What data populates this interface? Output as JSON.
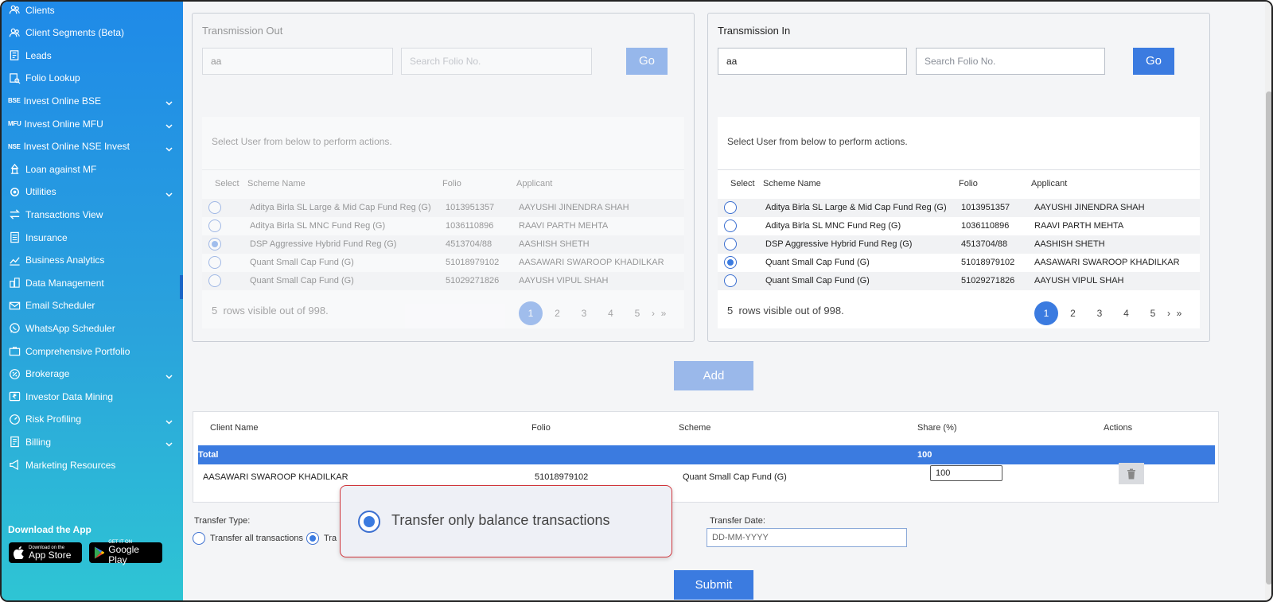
{
  "sidebar": {
    "items": [
      {
        "label": "Clients",
        "icon": "users-icon",
        "tag": "",
        "chevron": false
      },
      {
        "label": "Client Segments (Beta)",
        "icon": "users-icon",
        "tag": "",
        "chevron": false
      },
      {
        "label": "Leads",
        "icon": "notepad-icon",
        "tag": "",
        "chevron": false
      },
      {
        "label": "Folio Lookup",
        "icon": "folio-search-icon",
        "tag": "",
        "chevron": false
      },
      {
        "label": "Invest Online BSE",
        "icon": "bse-icon",
        "tag": "BSE",
        "chevron": true
      },
      {
        "label": "Invest Online MFU",
        "icon": "mfu-icon",
        "tag": "MFU",
        "chevron": true
      },
      {
        "label": "Invest Online NSE Invest",
        "icon": "nse-icon",
        "tag": "NSE",
        "chevron": true
      },
      {
        "label": "Loan against MF",
        "icon": "loan-icon",
        "tag": "",
        "chevron": false
      },
      {
        "label": "Utilities",
        "icon": "utilities-icon",
        "tag": "",
        "chevron": true
      },
      {
        "label": "Transactions View",
        "icon": "transfer-arrows-icon",
        "tag": "",
        "chevron": false
      },
      {
        "label": "Insurance",
        "icon": "document-icon",
        "tag": "",
        "chevron": false
      },
      {
        "label": "Business Analytics",
        "icon": "line-chart-icon",
        "tag": "",
        "chevron": false
      },
      {
        "label": "Data Management",
        "icon": "data-icon",
        "tag": "",
        "chevron": false
      },
      {
        "label": "Email Scheduler",
        "icon": "email-icon",
        "tag": "",
        "chevron": false
      },
      {
        "label": "WhatsApp Scheduler",
        "icon": "whatsapp-icon",
        "tag": "",
        "chevron": false
      },
      {
        "label": "Comprehensive Portfolio",
        "icon": "briefcase-icon",
        "tag": "",
        "chevron": false
      },
      {
        "label": "Brokerage",
        "icon": "percent-icon",
        "tag": "",
        "chevron": true
      },
      {
        "label": "Investor Data Mining",
        "icon": "rupee-icon",
        "tag": "",
        "chevron": false
      },
      {
        "label": "Risk Profiling",
        "icon": "gauge-icon",
        "tag": "",
        "chevron": true
      },
      {
        "label": "Billing",
        "icon": "billing-icon",
        "tag": "",
        "chevron": true
      },
      {
        "label": "Marketing Resources",
        "icon": "marketing-icon",
        "tag": "",
        "chevron": false
      }
    ],
    "download_title": "Download the App",
    "app_store": {
      "small": "Download on the",
      "big": "App Store"
    },
    "google_play": {
      "small": "GET IT ON",
      "big": "Google Play"
    }
  },
  "transmission_out": {
    "title": "Transmission Out",
    "search_value": "aa",
    "folio_placeholder": "Search Folio No.",
    "go_label": "Go",
    "hint": "Select User from below to perform actions.",
    "columns": [
      "Select",
      "Scheme Name",
      "Folio",
      "Applicant"
    ],
    "rows": [
      {
        "scheme": "Aditya Birla SL Large & Mid Cap Fund Reg (G)",
        "folio": "1013951357",
        "applicant": "AAYUSHI JINENDRA SHAH",
        "selected": false
      },
      {
        "scheme": "Aditya Birla SL MNC Fund Reg (G)",
        "folio": "1036110896",
        "applicant": "RAAVI PARTH MEHTA",
        "selected": false
      },
      {
        "scheme": "DSP Aggressive Hybrid Fund Reg (G)",
        "folio": "4513704/88",
        "applicant": "AASHISH SHETH",
        "selected": true
      },
      {
        "scheme": "Quant Small Cap Fund (G)",
        "folio": "51018979102",
        "applicant": "AASAWARI SWAROOP KHADILKAR",
        "selected": false
      },
      {
        "scheme": "Quant Small Cap Fund (G)",
        "folio": "51029271826",
        "applicant": "AAYUSH VIPUL SHAH",
        "selected": false
      }
    ],
    "rows_info_count": "5",
    "rows_info_text": "rows visible out of 998.",
    "pages": [
      "1",
      "2",
      "3",
      "4",
      "5"
    ],
    "next": "›",
    "last": "»"
  },
  "transmission_in": {
    "title": "Transmission In",
    "search_value": "aa",
    "folio_placeholder": "Search Folio No.",
    "go_label": "Go",
    "hint": "Select User from below to perform actions.",
    "columns": [
      "Select",
      "Scheme Name",
      "Folio",
      "Applicant"
    ],
    "rows": [
      {
        "scheme": "Aditya Birla SL Large & Mid Cap Fund Reg (G)",
        "folio": "1013951357",
        "applicant": "AAYUSHI JINENDRA SHAH",
        "selected": false
      },
      {
        "scheme": "Aditya Birla SL MNC Fund Reg (G)",
        "folio": "1036110896",
        "applicant": "RAAVI PARTH MEHTA",
        "selected": false
      },
      {
        "scheme": "DSP Aggressive Hybrid Fund Reg (G)",
        "folio": "4513704/88",
        "applicant": "AASHISH SHETH",
        "selected": false
      },
      {
        "scheme": "Quant Small Cap Fund (G)",
        "folio": "51018979102",
        "applicant": "AASAWARI SWAROOP KHADILKAR",
        "selected": true
      },
      {
        "scheme": "Quant Small Cap Fund (G)",
        "folio": "51029271826",
        "applicant": "AAYUSH VIPUL SHAH",
        "selected": false
      }
    ],
    "rows_info_count": "5",
    "rows_info_text": "rows visible out of 998.",
    "pages": [
      "1",
      "2",
      "3",
      "4",
      "5"
    ],
    "next": "›",
    "last": "»"
  },
  "add_label": "Add",
  "summary": {
    "columns": {
      "client": "Client Name",
      "folio": "Folio",
      "scheme": "Scheme",
      "share": "Share (%)",
      "actions": "Actions"
    },
    "total": {
      "label": "Total",
      "share": "100"
    },
    "row": {
      "client": "AASAWARI SWAROOP KHADILKAR",
      "folio": "51018979102",
      "scheme": "Quant Small Cap Fund (G)",
      "share": "100"
    }
  },
  "transfer": {
    "type_label": "Transfer Type:",
    "option_all": "Transfer all transactions",
    "option_balance_partial": "Tra",
    "date_label": "Transfer Date:",
    "date_placeholder": "DD-MM-YYYY"
  },
  "submit_label": "Submit",
  "callout": {
    "text": "Transfer only balance transactions"
  },
  "colors": {
    "accent": "#3b7be0",
    "sidebar_top": "#1f8ae8",
    "sidebar_bottom": "#2ec5d4",
    "callout_border": "#d0353b"
  }
}
